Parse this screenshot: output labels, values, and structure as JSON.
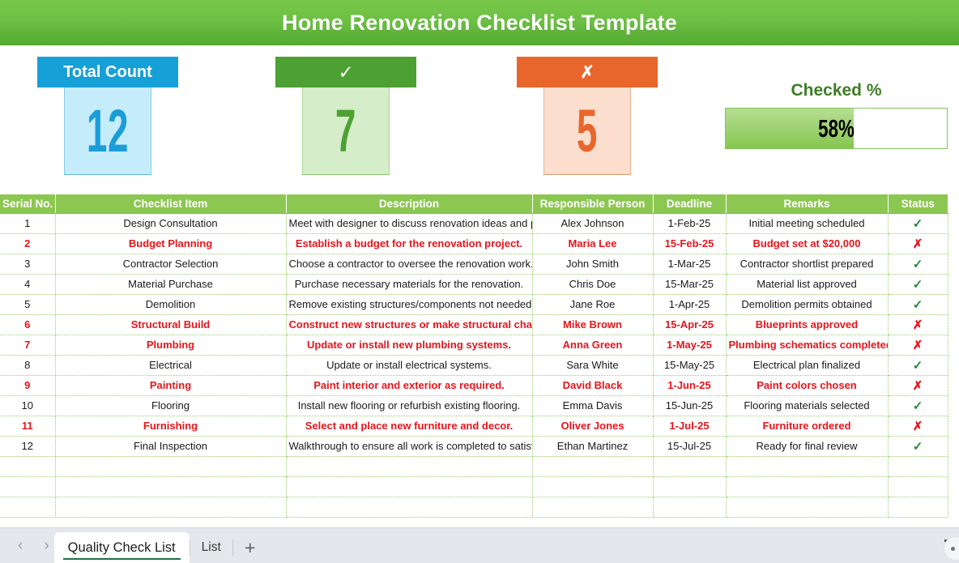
{
  "header": {
    "title": "Home Renovation Checklist Template"
  },
  "kpis": {
    "total": {
      "label": "Total Count",
      "value": "12"
    },
    "checked": {
      "label": "✓",
      "value": "7"
    },
    "unchecked": {
      "label": "✗",
      "value": "5"
    },
    "percent": {
      "label": "Checked %",
      "value": "58%",
      "fill_ratio": 58
    }
  },
  "table": {
    "columns": [
      "Serial No.",
      "Checklist Item",
      "Description",
      "Responsible Person",
      "Deadline",
      "Remarks",
      "Status"
    ],
    "rows": [
      {
        "serial": "1",
        "item": "Design Consultation",
        "description": "Meet with designer to discuss renovation ideas and plans.",
        "person": "Alex Johnson",
        "deadline": "1-Feb-25",
        "remarks": "Initial meeting scheduled",
        "status": "✓",
        "status_state": "checked",
        "flagged": false
      },
      {
        "serial": "2",
        "item": "Budget Planning",
        "description": "Establish a budget for the renovation project.",
        "person": "Maria Lee",
        "deadline": "15-Feb-25",
        "remarks": "Budget set at $20,000",
        "status": "✗",
        "status_state": "unchecked",
        "flagged": true
      },
      {
        "serial": "3",
        "item": "Contractor Selection",
        "description": "Choose a contractor to oversee the renovation work.",
        "person": "John Smith",
        "deadline": "1-Mar-25",
        "remarks": "Contractor shortlist prepared",
        "status": "✓",
        "status_state": "checked",
        "flagged": false
      },
      {
        "serial": "4",
        "item": "Material Purchase",
        "description": "Purchase necessary materials for the renovation.",
        "person": "Chris Doe",
        "deadline": "15-Mar-25",
        "remarks": "Material list approved",
        "status": "✓",
        "status_state": "checked",
        "flagged": false
      },
      {
        "serial": "5",
        "item": "Demolition",
        "description": "Remove existing structures/components not needed.",
        "person": "Jane Roe",
        "deadline": "1-Apr-25",
        "remarks": "Demolition permits obtained",
        "status": "✓",
        "status_state": "checked",
        "flagged": false
      },
      {
        "serial": "6",
        "item": "Structural Build",
        "description": "Construct new structures or make structural changes.",
        "person": "Mike Brown",
        "deadline": "15-Apr-25",
        "remarks": "Blueprints approved",
        "status": "✗",
        "status_state": "unchecked",
        "flagged": true
      },
      {
        "serial": "7",
        "item": "Plumbing",
        "description": "Update or install new plumbing systems.",
        "person": "Anna Green",
        "deadline": "1-May-25",
        "remarks": "Plumbing schematics completed",
        "status": "✗",
        "status_state": "unchecked",
        "flagged": true
      },
      {
        "serial": "8",
        "item": "Electrical",
        "description": "Update or install electrical systems.",
        "person": "Sara White",
        "deadline": "15-May-25",
        "remarks": "Electrical plan finalized",
        "status": "✓",
        "status_state": "checked",
        "flagged": false
      },
      {
        "serial": "9",
        "item": "Painting",
        "description": "Paint interior and exterior as required.",
        "person": "David Black",
        "deadline": "1-Jun-25",
        "remarks": "Paint colors chosen",
        "status": "✗",
        "status_state": "unchecked",
        "flagged": true
      },
      {
        "serial": "10",
        "item": "Flooring",
        "description": "Install new flooring or refurbish existing flooring.",
        "person": "Emma Davis",
        "deadline": "15-Jun-25",
        "remarks": "Flooring materials selected",
        "status": "✓",
        "status_state": "checked",
        "flagged": false
      },
      {
        "serial": "11",
        "item": "Furnishing",
        "description": "Select and place new furniture and decor.",
        "person": "Oliver Jones",
        "deadline": "1-Jul-25",
        "remarks": "Furniture ordered",
        "status": "✗",
        "status_state": "unchecked",
        "flagged": true
      },
      {
        "serial": "12",
        "item": "Final Inspection",
        "description": "Walkthrough to ensure all work is completed to satisfaction.",
        "person": "Ethan Martinez",
        "deadline": "15-Jul-25",
        "remarks": "Ready for final review",
        "status": "✓",
        "status_state": "checked",
        "flagged": false
      }
    ],
    "empty_row_count": 3
  },
  "tabbar": {
    "prev_icon": "‹",
    "next_icon": "›",
    "tabs": [
      {
        "label": "Quality Check List",
        "active": true
      },
      {
        "label": "List",
        "active": false
      }
    ],
    "add_label": "+"
  },
  "colors": {
    "banner_green": "#6cc043",
    "header_green": "#8cc751",
    "blue": "#16a0d8",
    "green": "#4da032",
    "orange": "#e8662b",
    "flag_red": "#e8151b",
    "tick_green": "#1e8a3c"
  }
}
